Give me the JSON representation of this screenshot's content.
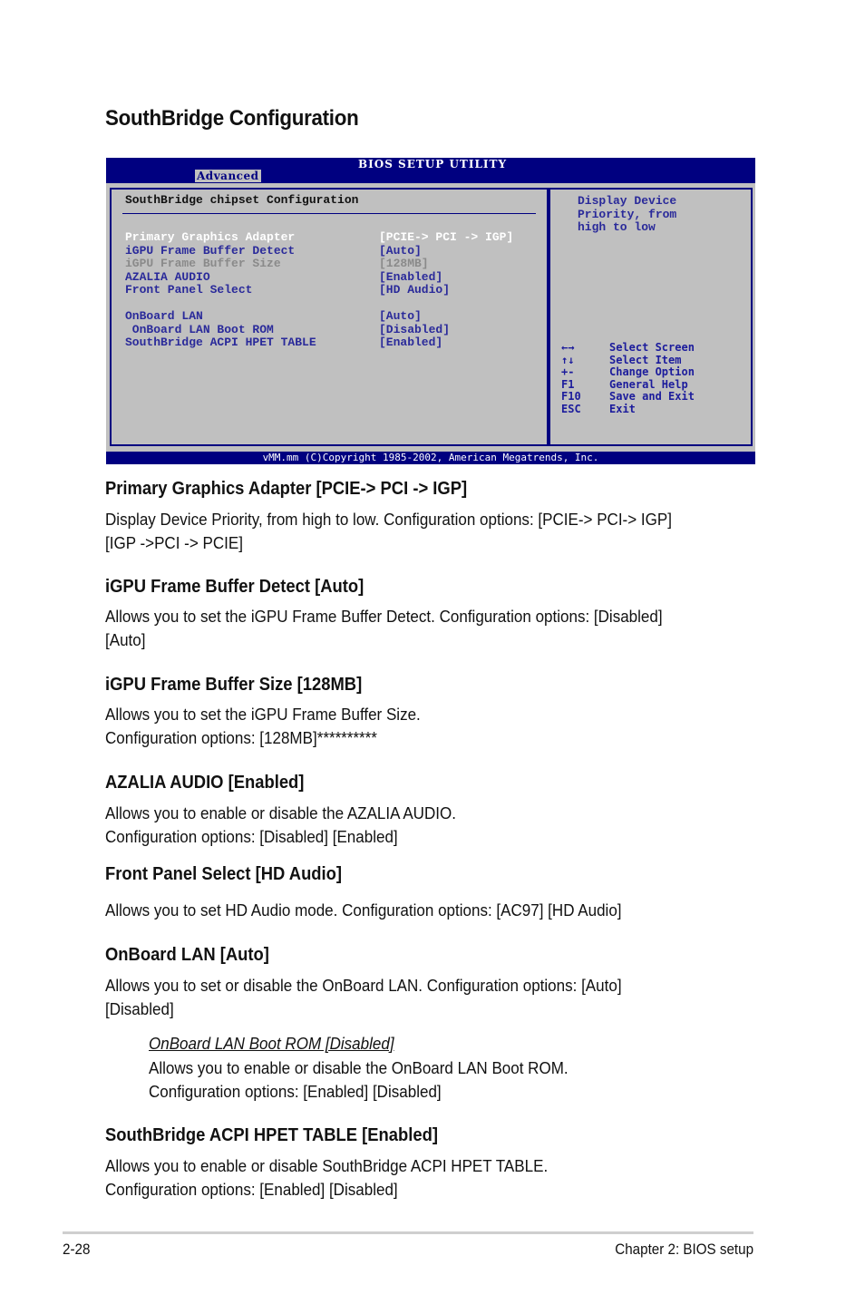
{
  "page_title": "SouthBridge Configuration",
  "bios": {
    "utility_title": "BIOS SETUP UTILITY",
    "active_tab": "Advanced",
    "section_title": "SouthBridge chipset Configuration",
    "options": [
      {
        "label": "Primary Graphics Adapter",
        "value": "[PCIE-> PCI -> IGP]",
        "state": "selected"
      },
      {
        "label": "iGPU Frame Buffer Detect",
        "value": "[Auto]",
        "state": "normal"
      },
      {
        "label": "iGPU Frame Buffer Size",
        "value": "[128MB]",
        "state": "disabled"
      },
      {
        "label": "AZALIA AUDIO",
        "value": "[Enabled]",
        "state": "normal"
      },
      {
        "label": "Front Panel Select",
        "value": "[HD Audio]",
        "state": "normal"
      },
      {
        "label": "OnBoard LAN",
        "value": "[Auto]",
        "state": "normal"
      },
      {
        "label": " OnBoard LAN Boot ROM",
        "value": "[Disabled]",
        "state": "normal"
      },
      {
        "label": "SouthBridge ACPI HPET TABLE",
        "value": "[Enabled]",
        "state": "normal"
      }
    ],
    "help_text": "Display Device\nPriority, from\nhigh to low",
    "keys": [
      {
        "key": "←→",
        "desc": "Select Screen",
        "icon": "left-right-arrows-icon"
      },
      {
        "key": "↑↓",
        "desc": "Select Item",
        "icon": "up-down-arrows-icon"
      },
      {
        "key": "+-",
        "desc": "Change Option",
        "icon": "plus-minus-icon"
      },
      {
        "key": "F1",
        "desc": "General Help"
      },
      {
        "key": "F10",
        "desc": "Save and Exit"
      },
      {
        "key": "ESC",
        "desc": "Exit"
      }
    ],
    "footer": "vMM.mm (C)Copyright 1985-2002, American Megatrends, Inc.",
    "colors": {
      "bar": "#000080",
      "panel": "#c0c0c0",
      "option_text": "#2a2a9a",
      "selected_text": "#ffffff",
      "disabled_text": "#8a8a8a"
    }
  },
  "sections": [
    {
      "heading": "Primary Graphics Adapter [PCIE-> PCI -> IGP]",
      "body": "Display Device Priority, from high to low. Configuration options: [PCIE-> PCI-> IGP]\n[IGP ->PCI -> PCIE]"
    },
    {
      "heading": "iGPU Frame Buffer Detect [Auto]",
      "body": "Allows you to set the iGPU Frame Buffer Detect. Configuration options: [Disabled]\n[Auto]"
    },
    {
      "heading": "iGPU Frame Buffer Size [128MB]",
      "body": "Allows you to set the iGPU Frame Buffer Size.\nConfiguration options: [128MB]**********"
    },
    {
      "heading": "AZALIA AUDIO [Enabled]",
      "body": "Allows you to enable or disable the AZALIA AUDIO.\nConfiguration options: [Disabled] [Enabled]"
    },
    {
      "heading": "Front Panel Select [HD Audio]",
      "body": "Allows you to set HD Audio mode. Configuration options: [AC97] [HD Audio]"
    },
    {
      "heading": "OnBoard LAN [Auto]",
      "body": "Allows you to set or disable the OnBoard LAN. Configuration options: [Auto]\n[Disabled]"
    },
    {
      "heading": "SouthBridge ACPI HPET TABLE [Enabled]",
      "body": "Allows you to enable or disable SouthBridge ACPI HPET TABLE.\nConfiguration options: [Enabled] [Disabled]"
    }
  ],
  "subsection": {
    "heading": "OnBoard LAN Boot ROM [Disabled]",
    "body": "Allows you to enable or disable the OnBoard LAN Boot ROM.\nConfiguration options: [Enabled] [Disabled]"
  },
  "footer": {
    "page_number": "2-28",
    "chapter": "Chapter 2: BIOS setup"
  }
}
